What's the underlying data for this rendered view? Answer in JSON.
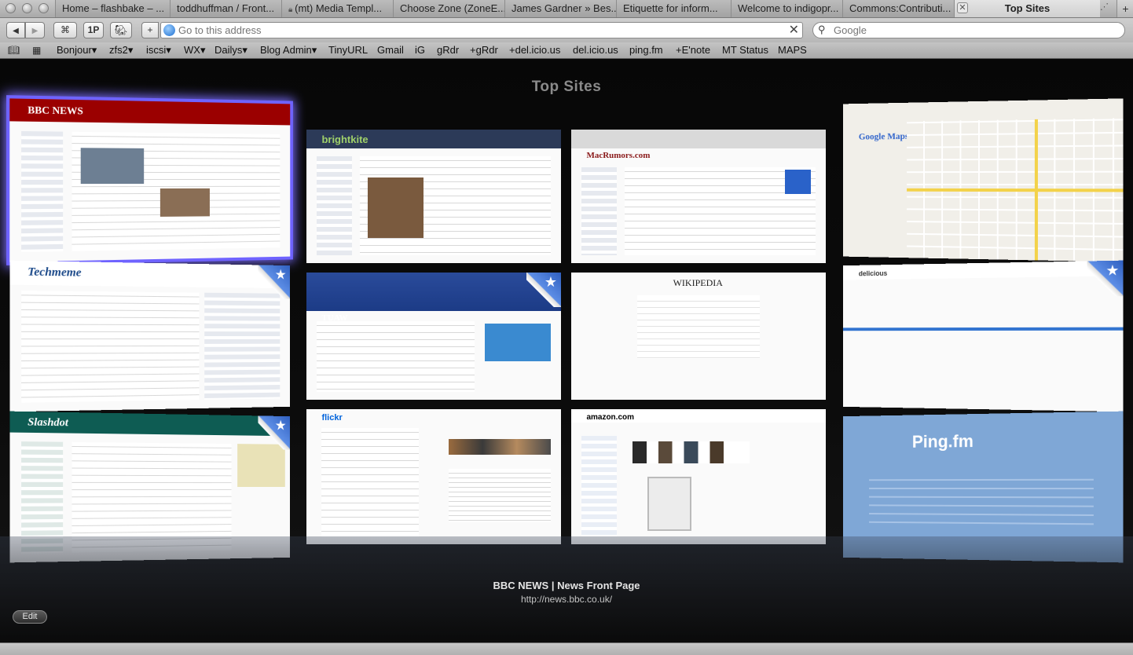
{
  "tabs": [
    {
      "label": "Home – flashbake – ..."
    },
    {
      "label": "toddhuffman / Front..."
    },
    {
      "label": "(mt) Media Templ..."
    },
    {
      "label": "Choose Zone (ZoneE..."
    },
    {
      "label": "James Gardner » Bes..."
    },
    {
      "label": "Etiquette for inform..."
    },
    {
      "label": "Welcome to indigopr..."
    },
    {
      "label": "Commons:Contributi..."
    },
    {
      "label": "Top Sites"
    }
  ],
  "new_tab_symbol": "+",
  "toolbar": {
    "back_symbol": "◀",
    "forward_symbol": "▶",
    "onepassword_label": "1P",
    "add_symbol": "+",
    "address_placeholder": "Go to this address",
    "clear_symbol": "✕",
    "search_placeholder": "Google"
  },
  "bookmarks": [
    {
      "label": "Bonjour▾"
    },
    {
      "label": "zfs2▾"
    },
    {
      "label": "iscsi▾"
    },
    {
      "label": "WX▾"
    },
    {
      "label": "Dailys▾"
    },
    {
      "label": "Blog Admin▾"
    },
    {
      "label": "TinyURL"
    },
    {
      "label": "Gmail"
    },
    {
      "label": "iG"
    },
    {
      "label": "gRdr"
    },
    {
      "label": "+gRdr"
    },
    {
      "label": "+del.icio.us"
    },
    {
      "label": "del.icio.us"
    },
    {
      "label": "ping.fm"
    },
    {
      "label": "+E'note"
    },
    {
      "label": "MT Status"
    },
    {
      "label": "MAPS"
    }
  ],
  "topsites": {
    "title": "Top Sites",
    "selected_title": "BBC NEWS | News Front Page",
    "selected_url": "http://news.bbc.co.uk/",
    "edit_label": "Edit",
    "thumbnails": [
      {
        "name": "BBC NEWS",
        "header_color": "#9b0000"
      },
      {
        "name": "brightkite",
        "header_color": "#2c3a58"
      },
      {
        "name": "MacRumors.com",
        "header_color": "#d9d9d9"
      },
      {
        "name": "Google Maps",
        "header_color": "#ffffff"
      },
      {
        "name": "Techmeme",
        "header_color": "#1c4a8a"
      },
      {
        "name": "TUAW",
        "header_color": "#2a4b9b"
      },
      {
        "name": "WIKIPEDIA",
        "header_color": "#ffffff"
      },
      {
        "name": "delicious",
        "header_color": "#3274d0"
      },
      {
        "name": "Slashdot",
        "header_color": "#0e5c53"
      },
      {
        "name": "flickr",
        "header_color": "#ffffff"
      },
      {
        "name": "amazon.com",
        "header_color": "#1b4e8f"
      },
      {
        "name": "Ping.fm",
        "header_color": "#7fa7d6"
      }
    ]
  }
}
